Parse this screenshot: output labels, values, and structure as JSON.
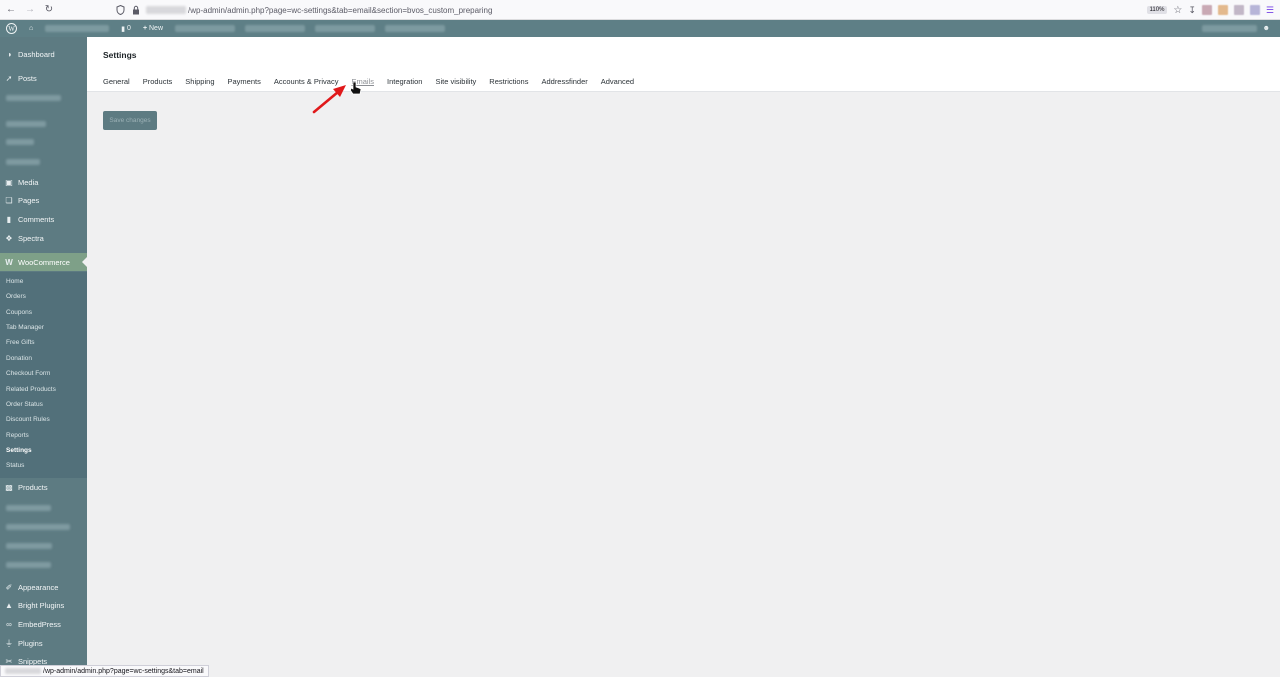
{
  "browser": {
    "url_path": "/wp-admin/admin.php?page=wc-settings&tab=email&section=bvos_custom_preparing",
    "zoom": "110%"
  },
  "adminbar": {
    "comments_count": "0",
    "new_label": "New"
  },
  "sidebar": {
    "items": [
      {
        "label": "Dashboard",
        "icon": "dashboard-icon"
      },
      {
        "label": "Posts",
        "icon": "pin-icon"
      },
      {
        "label": "Media",
        "icon": "media-icon"
      },
      {
        "label": "Pages",
        "icon": "pages-icon"
      },
      {
        "label": "Comments",
        "icon": "comment-icon"
      },
      {
        "label": "Spectra",
        "icon": "spectra-icon"
      },
      {
        "label": "WooCommerce",
        "icon": "woo-icon"
      },
      {
        "label": "Products",
        "icon": "box-icon"
      },
      {
        "label": "Appearance",
        "icon": "brush-icon"
      },
      {
        "label": "Bright Plugins",
        "icon": "bright-plugins-icon"
      },
      {
        "label": "EmbedPress",
        "icon": "link-icon"
      },
      {
        "label": "Plugins",
        "icon": "plug-icon"
      },
      {
        "label": "Snippets",
        "icon": "scissors-icon"
      }
    ],
    "woo_submenu": [
      "Home",
      "Orders",
      "Coupons",
      "Tab Manager",
      "Free Gifts",
      "Donation",
      "Checkout Form",
      "Related Products",
      "Order Status",
      "Discount Rules",
      "Reports",
      "Settings",
      "Status"
    ]
  },
  "main": {
    "title": "Settings",
    "tabs": [
      "General",
      "Products",
      "Shipping",
      "Payments",
      "Accounts & Privacy",
      "Emails",
      "Integration",
      "Site visibility",
      "Restrictions",
      "Addressfinder",
      "Advanced"
    ],
    "save_label": "Save changes"
  },
  "status_url": "/wp-admin/admin.php?page=wc-settings&tab=email",
  "colors": {
    "sidebar": "#5d7b82",
    "active_menu": "#7ea088",
    "annotation_arrow": "#e0191b"
  }
}
